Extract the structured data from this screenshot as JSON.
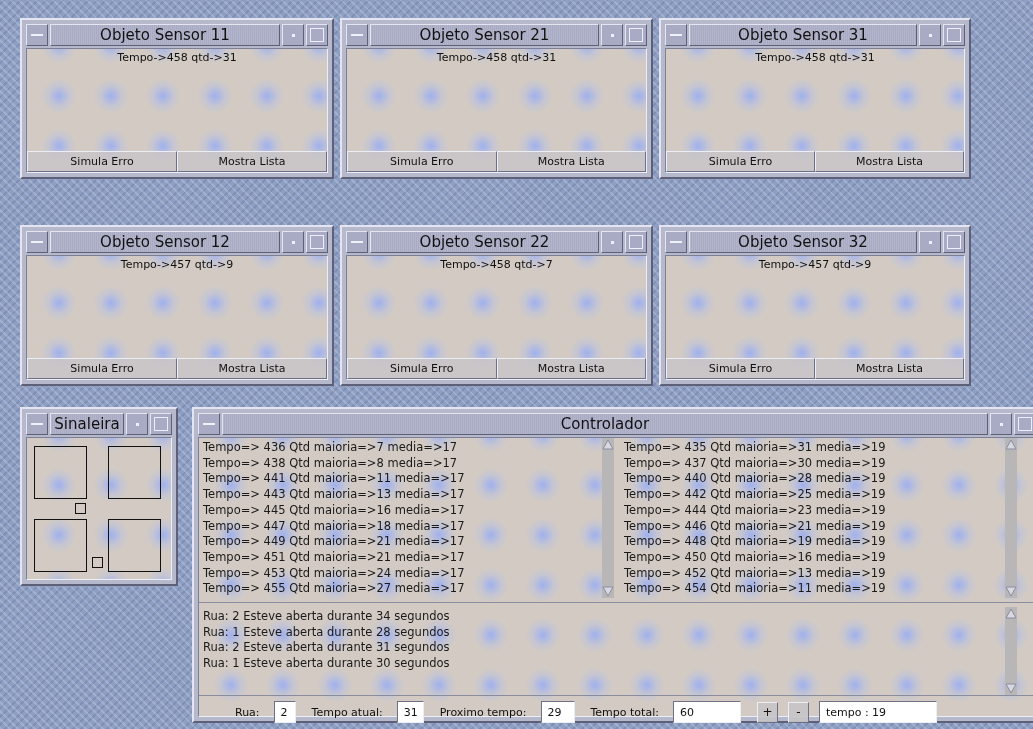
{
  "sensors": [
    {
      "title": "Objeto Sensor 11",
      "reading": "Tempo->458 qtd->31",
      "buttons": [
        "Simula Erro",
        "Mostra Lista"
      ]
    },
    {
      "title": "Objeto Sensor 21",
      "reading": "Tempo->458 qtd->31",
      "buttons": [
        "Simula Erro",
        "Mostra Lista"
      ]
    },
    {
      "title": "Objeto Sensor 31",
      "reading": "Tempo->458 qtd->31",
      "buttons": [
        "Simula Erro",
        "Mostra Lista"
      ]
    },
    {
      "title": "Objeto Sensor 12",
      "reading": "Tempo->457 qtd->9",
      "buttons": [
        "Simula Erro",
        "Mostra Lista"
      ]
    },
    {
      "title": "Objeto Sensor 22",
      "reading": "Tempo->458 qtd->7",
      "buttons": [
        "Simula Erro",
        "Mostra Lista"
      ]
    },
    {
      "title": "Objeto Sensor 32",
      "reading": "Tempo->457 qtd->9",
      "buttons": [
        "Simula Erro",
        "Mostra Lista"
      ]
    }
  ],
  "sinaleira": {
    "title": "Sinaleira"
  },
  "controlador": {
    "title": "Controlador",
    "left_list": [
      "Tempo=> 436 Qtd maioria=>7 media=>17",
      "Tempo=> 438 Qtd maioria=>8 media=>17",
      "Tempo=> 441 Qtd maioria=>11 media=>17",
      "Tempo=> 443 Qtd maioria=>13 media=>17",
      "Tempo=> 445 Qtd maioria=>16 media=>17",
      "Tempo=> 447 Qtd maioria=>18 media=>17",
      "Tempo=> 449 Qtd maioria=>21 media=>17",
      "Tempo=> 451 Qtd maioria=>21 media=>17",
      "Tempo=> 453 Qtd maioria=>24 media=>17",
      "Tempo=> 455 Qtd maioria=>27 media=>17"
    ],
    "right_list": [
      "Tempo=> 435 Qtd maioria=>31 media=>19",
      "Tempo=> 437 Qtd maioria=>30 media=>19",
      "Tempo=> 440 Qtd maioria=>28 media=>19",
      "Tempo=> 442 Qtd maioria=>25 media=>19",
      "Tempo=> 444 Qtd maioria=>23 media=>19",
      "Tempo=> 446 Qtd maioria=>21 media=>19",
      "Tempo=> 448 Qtd maioria=>19 media=>19",
      "Tempo=> 450 Qtd maioria=>16 media=>19",
      "Tempo=> 452 Qtd maioria=>13 media=>19",
      "Tempo=> 454 Qtd maioria=>11 media=>19"
    ],
    "log": [
      "Rua: 2 Esteve aberta durante 34 segundos",
      "Rua: 1 Esteve aberta durante 28 segundos",
      "Rua: 2 Esteve aberta durante 31 segundos",
      "Rua: 1 Esteve aberta durante 30 segundos"
    ],
    "fields": [
      {
        "label": "Rua:",
        "value": "2"
      },
      {
        "label": "Tempo atual:",
        "value": "31"
      },
      {
        "label": "Proximo tempo:",
        "value": "29"
      },
      {
        "label": "Tempo total:",
        "value": "60"
      }
    ],
    "buttons": [
      "+",
      "-"
    ],
    "status_field": {
      "value": "tempo : 19"
    }
  }
}
